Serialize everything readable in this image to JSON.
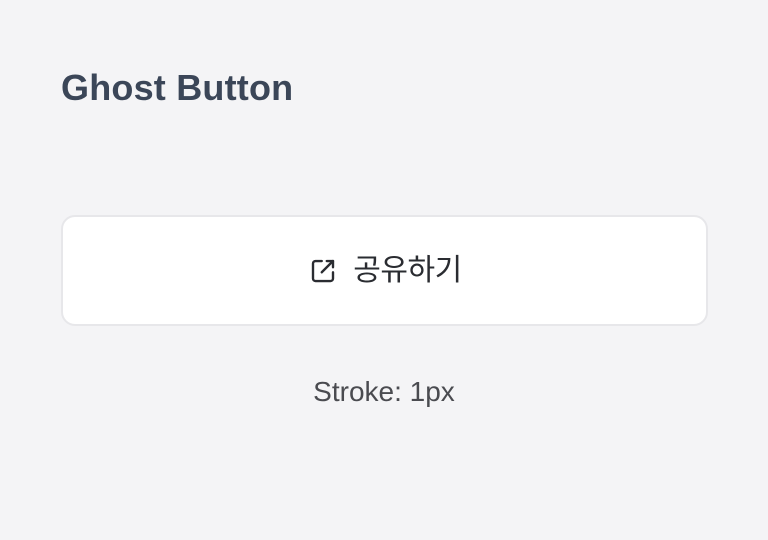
{
  "title": "Ghost Button",
  "button": {
    "icon": "external-link-icon",
    "label": "공유하기"
  },
  "caption": "Stroke: 1px",
  "colors": {
    "background": "#f4f4f6",
    "title": "#3b4658",
    "button_background": "#ffffff",
    "button_border": "#e7e7ea",
    "button_text": "#2a2c31",
    "caption": "#4a4b50"
  }
}
